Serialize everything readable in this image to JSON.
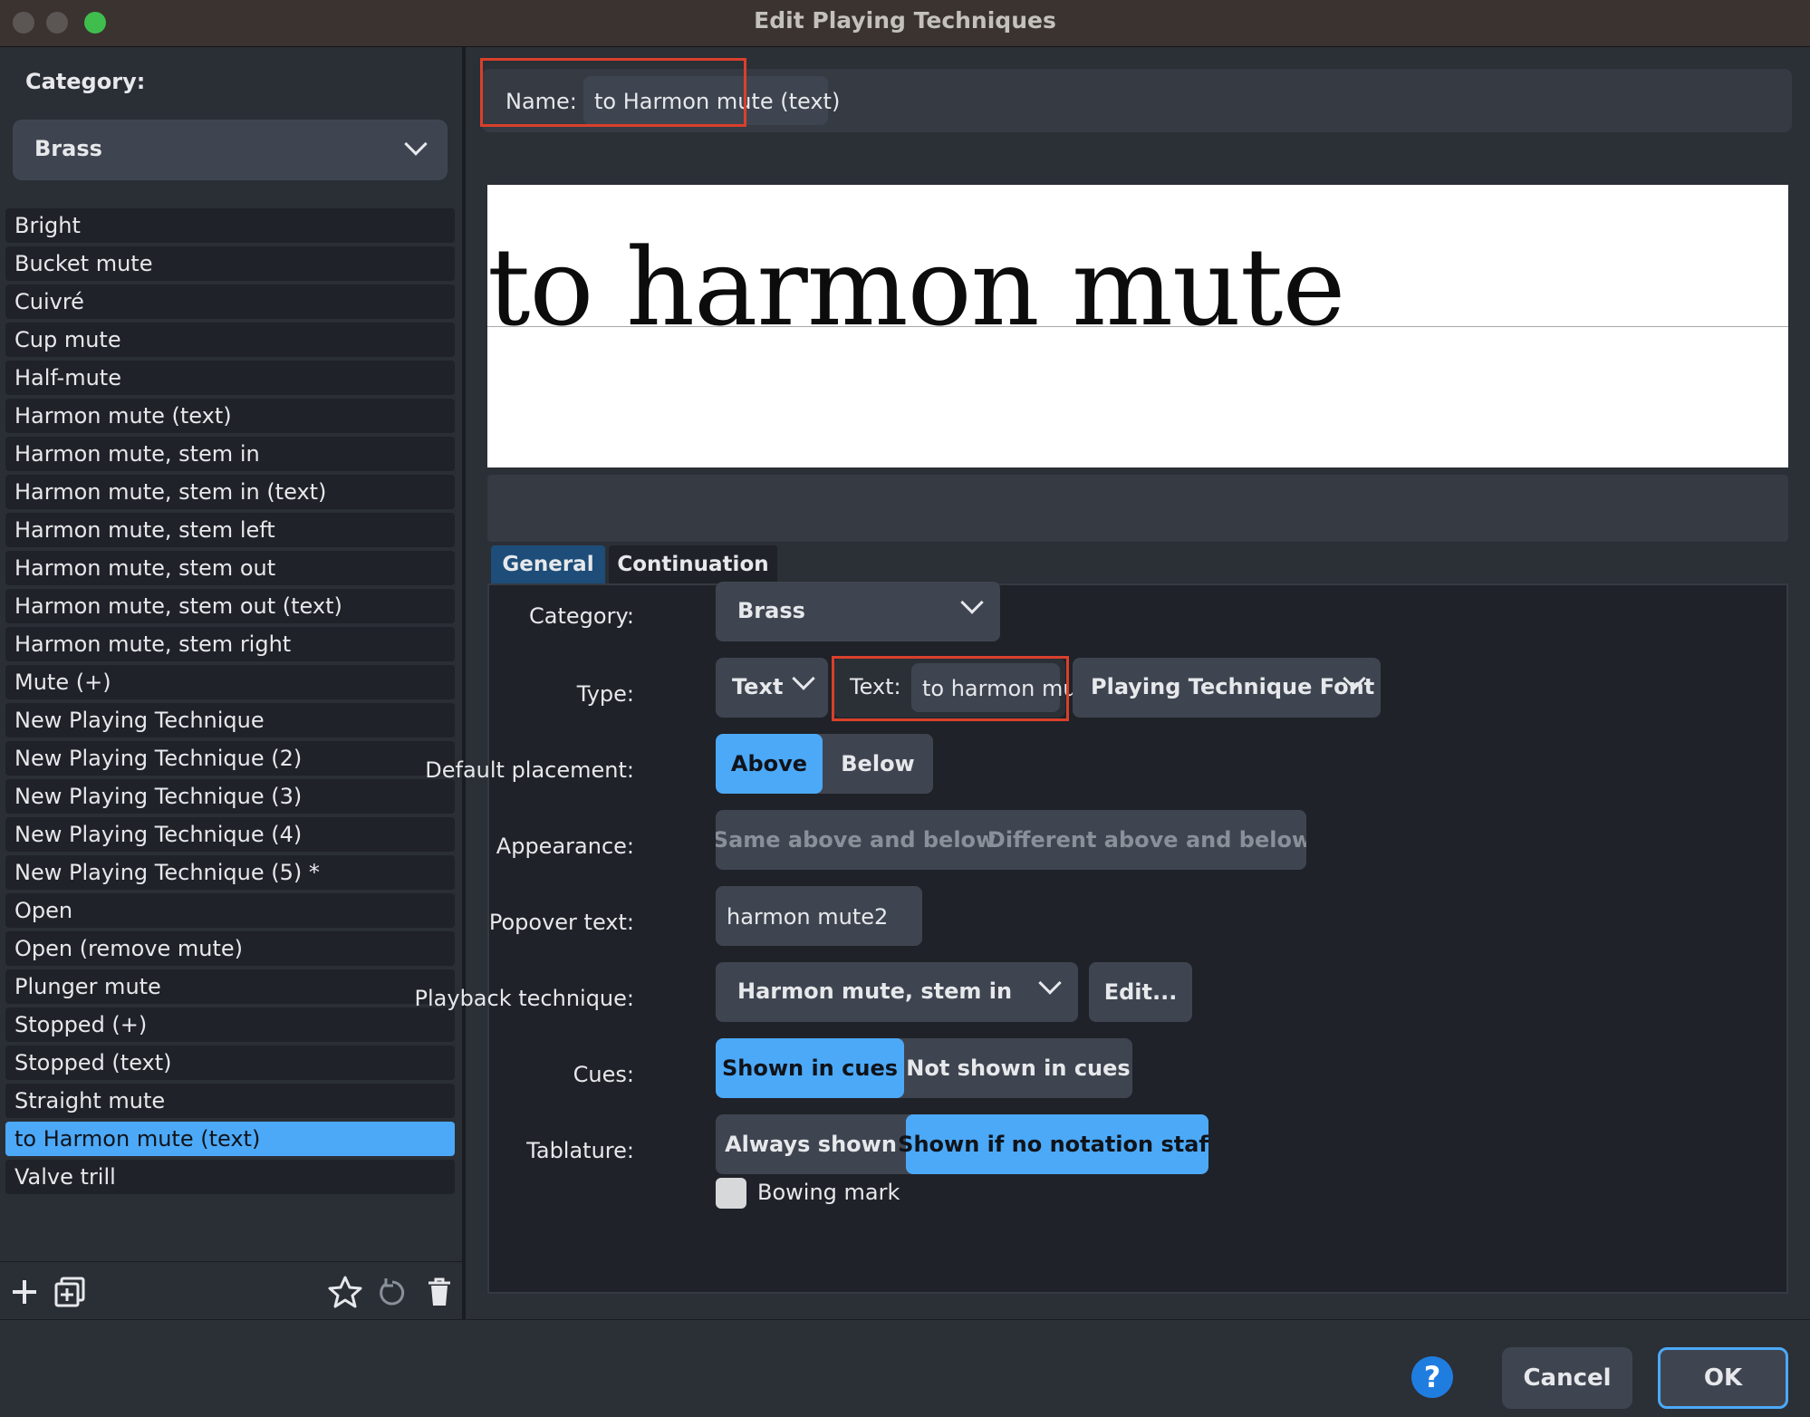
{
  "window": {
    "title": "Edit Playing Techniques"
  },
  "left": {
    "category_label": "Category:",
    "category_value": "Brass",
    "items": [
      "Bright",
      "Bucket mute",
      "Cuivré",
      "Cup mute",
      "Half-mute",
      "Harmon mute (text)",
      "Harmon mute, stem in",
      "Harmon mute, stem in (text)",
      "Harmon mute, stem left",
      "Harmon mute, stem out",
      "Harmon mute, stem out (text)",
      "Harmon mute, stem right",
      "Mute (+)",
      "New Playing Technique",
      "New Playing Technique (2)",
      "New Playing Technique (3)",
      "New Playing Technique (4)",
      "New Playing Technique (5) *",
      "Open",
      "Open (remove mute)",
      "Plunger mute",
      "Stopped (+)",
      "Stopped (text)",
      "Straight mute",
      "to Harmon mute (text)",
      "Valve trill"
    ],
    "selected_index": 24
  },
  "main": {
    "name_label": "Name:",
    "name_value": "to Harmon mute (text)",
    "preview_text": "to harmon mute",
    "tabs": [
      "General",
      "Continuation"
    ],
    "fields": {
      "category_label": "Category:",
      "category_value": "Brass",
      "type_label": "Type:",
      "type_value": "Text",
      "text_label": "Text:",
      "text_value": "to harmon mute",
      "font_value": "Playing Technique Font",
      "placement_label": "Default placement:",
      "placement_options": [
        "Above",
        "Below"
      ],
      "appearance_label": "Appearance:",
      "appearance_options": [
        "Same above and below",
        "Different above and below"
      ],
      "popover_label": "Popover text:",
      "popover_value": "harmon mute2",
      "playback_label": "Playback technique:",
      "playback_value": "Harmon mute, stem in",
      "edit_label": "Edit...",
      "cues_label": "Cues:",
      "cues_options": [
        "Shown in cues",
        "Not shown in cues"
      ],
      "tablature_label": "Tablature:",
      "tablature_options": [
        "Always shown",
        "Shown if no notation staff"
      ],
      "bowing_label": "Bowing mark"
    }
  },
  "footer": {
    "help": "?",
    "cancel": "Cancel",
    "ok": "OK"
  },
  "colors": {
    "accent": "#4ca9f7",
    "highlight": "#d9402b"
  }
}
